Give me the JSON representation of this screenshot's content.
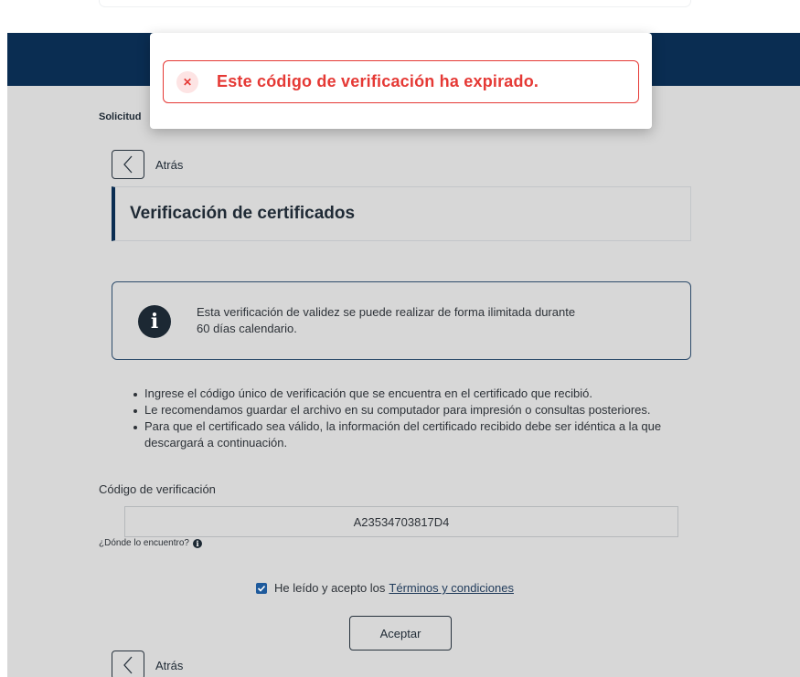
{
  "header": {
    "breadcrumb": "Solicitud"
  },
  "nav": {
    "back_label": "Atrás"
  },
  "page": {
    "title": "Verificación de certificados"
  },
  "info_box": {
    "icon": "info-icon",
    "line1": "Esta verificación de validez se puede realizar de forma ilimitada durante",
    "line2": "60 días calendario."
  },
  "instructions": [
    "Ingrese el código único de verificación que se encuentra en el certificado que recibió.",
    "Le recomendamos guardar el archivo en su computador para impresión o consultas posteriores.",
    "Para que el certificado sea válido, la información del certificado recibido debe ser idéntica a la que descargará a continuación."
  ],
  "form": {
    "code_label": "Código de verificación",
    "code_value": "A23534703817D4",
    "help_text": "¿Dónde lo encuentro?",
    "terms_prefix": "He leído y acepto los",
    "terms_link": "Términos y condiciones",
    "terms_checked": true,
    "accept_label": "Aceptar"
  },
  "modal": {
    "icon": "close-icon",
    "message": "Este código de verificación ha expirado."
  },
  "colors": {
    "navy": "#0a2d52",
    "error": "#e53935",
    "overlay": "#d7d7d7"
  }
}
